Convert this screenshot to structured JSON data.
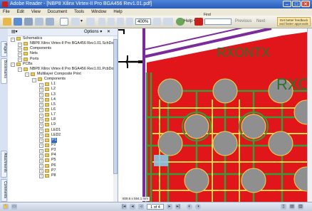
{
  "window": {
    "title": "Adobe Reader - [NBP8 Xilinx Virtex-II Pro BGA456 Rev1.01.pdf]",
    "minimize": "–",
    "maximize": "□",
    "close": "✕"
  },
  "menu": [
    "File",
    "Edit",
    "View",
    "Document",
    "Tools",
    "Window",
    "Help"
  ],
  "toolbar": {
    "zoom_value": "400%",
    "select_label": "▾",
    "help_label": "Help ▾",
    "find_label": "Find",
    "previous_label": "Previous",
    "next_label": "Next",
    "feedback_label": "Get better feedback and faster approvals",
    "colors": {
      "accent": "#316ac5"
    }
  },
  "left_tabs": [
    "Pages",
    "Bookmarks",
    "Attachments",
    "Comments"
  ],
  "bookmarks_panel": {
    "options_label": "Options ▾",
    "close_label": "✕",
    "tree": [
      {
        "level": 0,
        "expander": "−",
        "label": "Schematics"
      },
      {
        "level": 1,
        "expander": "+",
        "label": "NBP8 Xilinx Virtex-II Pro BGA456 Rev1.01.SchDoc"
      },
      {
        "level": 1,
        "expander": "+",
        "label": "Components"
      },
      {
        "level": 1,
        "expander": "+",
        "label": "Nets"
      },
      {
        "level": 1,
        "expander": "+",
        "label": "Ports"
      },
      {
        "level": 0,
        "expander": "−",
        "label": "PCBs"
      },
      {
        "level": 1,
        "expander": "−",
        "label": "NBP8 Xilinx Virtex-II Pro BGA456 Rev1.01.PcbDoc"
      },
      {
        "level": 2,
        "expander": "−",
        "label": "Multilayer Composite Print"
      },
      {
        "level": 3,
        "expander": "−",
        "label": "Components"
      },
      {
        "level": 4,
        "expander": "+",
        "label": "L1"
      },
      {
        "level": 4,
        "expander": "+",
        "label": "L2"
      },
      {
        "level": 4,
        "expander": "+",
        "label": "L3"
      },
      {
        "level": 4,
        "expander": "+",
        "label": "L4"
      },
      {
        "level": 4,
        "expander": "+",
        "label": "L5"
      },
      {
        "level": 4,
        "expander": "+",
        "label": "L6"
      },
      {
        "level": 4,
        "expander": "+",
        "label": "L7"
      },
      {
        "level": 4,
        "expander": "+",
        "label": "L8"
      },
      {
        "level": 4,
        "expander": "+",
        "label": "L9"
      },
      {
        "level": 4,
        "expander": "+",
        "label": "LED1"
      },
      {
        "level": 4,
        "expander": "+",
        "label": "LED2"
      },
      {
        "level": 4,
        "expander": "+",
        "label": "P1",
        "selected": true
      },
      {
        "level": 4,
        "expander": "+",
        "label": "P2"
      },
      {
        "level": 4,
        "expander": "+",
        "label": "P3"
      },
      {
        "level": 4,
        "expander": "+",
        "label": "P4"
      },
      {
        "level": 4,
        "expander": "+",
        "label": "P5"
      },
      {
        "level": 4,
        "expander": "+",
        "label": "P6"
      },
      {
        "level": 4,
        "expander": "+",
        "label": "P7"
      },
      {
        "level": 4,
        "expander": "+",
        "label": "P8"
      }
    ]
  },
  "document": {
    "silkscreen_text_1": "RXONTX",
    "silkscreen_text_2": "RXO",
    "page_size_label": "609.6 x 594.1 mm",
    "colors": {
      "board": "#e0161a",
      "outline": "#7a2a9a",
      "pad": "#8f8f8f",
      "trace": "#3b9a3b",
      "silk": "#f4d84a"
    }
  },
  "status": {
    "page_value": "1 of 4"
  }
}
